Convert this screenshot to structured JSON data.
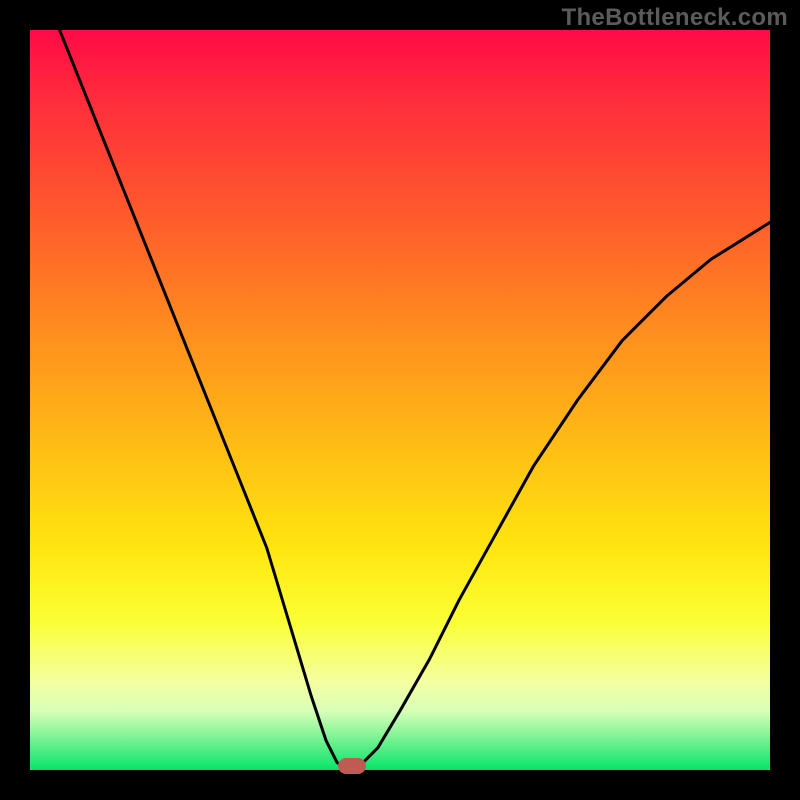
{
  "watermark": "TheBottleneck.com",
  "chart_data": {
    "type": "line",
    "title": "",
    "xlabel": "",
    "ylabel": "",
    "xlim": [
      0,
      100
    ],
    "ylim": [
      0,
      100
    ],
    "series": [
      {
        "name": "bottleneck-curve",
        "x": [
          4,
          8,
          12,
          16,
          20,
          24,
          28,
          32,
          35,
          38,
          40,
          41.5,
          43,
          44,
          47,
          50,
          54,
          58,
          63,
          68,
          74,
          80,
          86,
          92,
          100
        ],
        "y": [
          100,
          90,
          80,
          70,
          60,
          50,
          40,
          30,
          20,
          10,
          4,
          1,
          0,
          0,
          3,
          8,
          15,
          23,
          32,
          41,
          50,
          58,
          64,
          69,
          74
        ]
      }
    ],
    "annotations": [
      {
        "name": "min-marker",
        "x": 43.5,
        "y": 0.6,
        "color": "#c15a52"
      }
    ],
    "background_gradient": {
      "stops": [
        {
          "pos": 0,
          "color": "#ff0b46"
        },
        {
          "pos": 10,
          "color": "#ff2e3b"
        },
        {
          "pos": 25,
          "color": "#ff5a2c"
        },
        {
          "pos": 40,
          "color": "#ff8b1f"
        },
        {
          "pos": 55,
          "color": "#ffb915"
        },
        {
          "pos": 70,
          "color": "#ffe60f"
        },
        {
          "pos": 80,
          "color": "#fbff35"
        },
        {
          "pos": 88,
          "color": "#f4ffa0"
        },
        {
          "pos": 92,
          "color": "#d8ffb8"
        },
        {
          "pos": 95,
          "color": "#8cf59a"
        },
        {
          "pos": 100,
          "color": "#06e46a"
        }
      ]
    }
  }
}
